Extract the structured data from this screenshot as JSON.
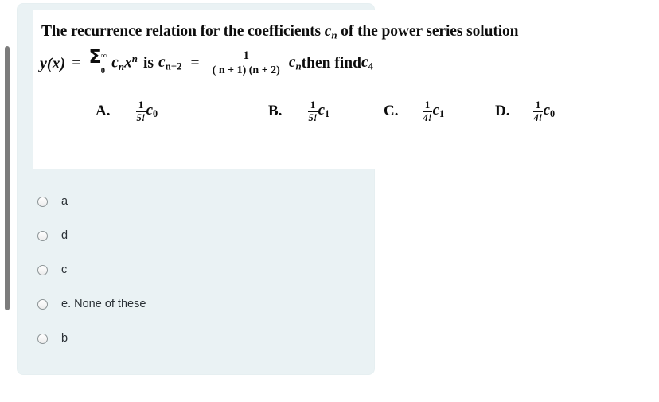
{
  "page": {
    "background_color": "#ffffff",
    "card_color": "#eaf2f4",
    "scrollbar_color": "#7c7c7c"
  },
  "question": {
    "stem_line1_prefix": "The recurrence relation for the coefficients ",
    "stem_line1_var": "c",
    "stem_line1_var_sub": "n",
    "stem_line1_suffix": " of the power series solution",
    "y_of_x": "y(x)",
    "equals": "=",
    "sigma": "Σ",
    "sigma_upper": "∞",
    "sigma_lower": "0",
    "series_term": "c",
    "series_term_sub": "n",
    "series_x": "x",
    "series_x_sup": "n",
    "is_word": "is",
    "lhs_coef": "c",
    "lhs_coef_sub": "n+2",
    "equals2": "=",
    "frac_num": "1",
    "frac_den": "( n + 1) (n + 2)",
    "rhs_coef": "c",
    "rhs_coef_sub": "n",
    "then_find": " then find ",
    "target_coef": "c",
    "target_coef_sub": "4"
  },
  "choices": [
    {
      "letter": "A.",
      "num": "1",
      "den": "5!",
      "coef": "c",
      "coef_sub": "0"
    },
    {
      "letter": "B.",
      "num": "1",
      "den": "5!",
      "coef": "c",
      "coef_sub": "1"
    },
    {
      "letter": "C.",
      "num": "1",
      "den": "4!",
      "coef": "c",
      "coef_sub": "1"
    },
    {
      "letter": "D.",
      "num": "1",
      "den": "4!",
      "coef": "c",
      "coef_sub": "0"
    }
  ],
  "options": [
    {
      "label": "a",
      "selected": false
    },
    {
      "label": "d",
      "selected": false
    },
    {
      "label": "c",
      "selected": false
    },
    {
      "label": "e. None of these",
      "selected": false
    },
    {
      "label": "b",
      "selected": false
    }
  ]
}
